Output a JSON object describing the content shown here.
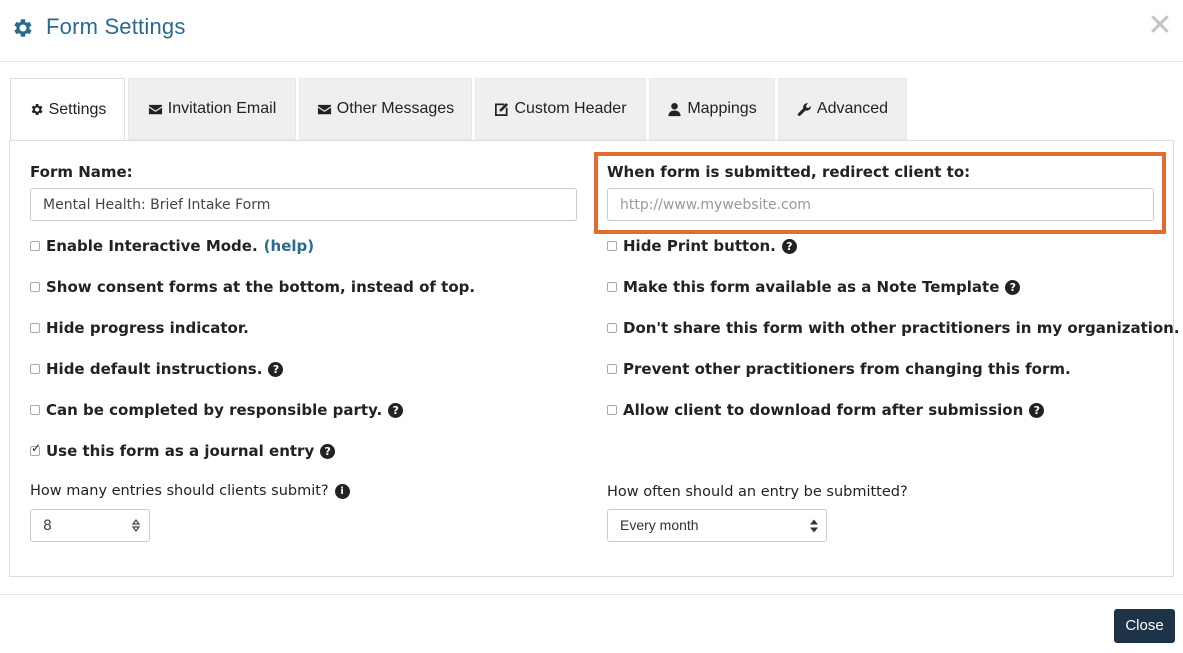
{
  "dialog": {
    "title": "Form Settings",
    "close_symbol": "✕",
    "icon": "gear-icon"
  },
  "tabs": [
    {
      "label": "Settings",
      "icon": "gear-icon",
      "active": true
    },
    {
      "label": "Invitation Email",
      "icon": "envelope-icon",
      "active": false
    },
    {
      "label": "Other Messages",
      "icon": "envelope-icon",
      "active": false
    },
    {
      "label": "Custom Header",
      "icon": "edit-icon",
      "active": false
    },
    {
      "label": "Mappings",
      "icon": "user-icon",
      "active": false
    },
    {
      "label": "Advanced",
      "icon": "wrench-icon",
      "active": false
    }
  ],
  "form": {
    "form_name_label": "Form Name:",
    "form_name_value": "Mental Health: Brief Intake Form",
    "redirect_label": "When form is submitted, redirect client to:",
    "redirect_placeholder": "http://www.mywebsite.com",
    "left_options": [
      {
        "label": "Enable Interactive Mode.",
        "help_link": "(help)",
        "checked": false
      },
      {
        "label": "Show consent forms at the bottom, instead of top.",
        "checked": false
      },
      {
        "label": "Hide progress indicator.",
        "checked": false
      },
      {
        "label": "Hide default instructions.",
        "checked": false,
        "help_icon": true
      },
      {
        "label": "Can be completed by responsible party.",
        "checked": false,
        "help_icon": true
      },
      {
        "label": "Use this form as a journal entry",
        "checked": true,
        "help_icon": true
      }
    ],
    "right_options": [
      {
        "label": "Hide Print button.",
        "checked": false,
        "help_icon": true
      },
      {
        "label": "Make this form available as a Note Template",
        "checked": false,
        "help_icon": true
      },
      {
        "label": "Don't share this form with other practitioners in my organization.",
        "checked": false
      },
      {
        "label": "Prevent other practitioners from changing this form.",
        "checked": false
      },
      {
        "label": "Allow client to download form after submission",
        "checked": false,
        "help_icon": true
      }
    ],
    "entries_label": "How many entries should clients submit?",
    "entries_value": "8",
    "frequency_label": "How often should an entry be submitted?",
    "frequency_value": "Every month"
  },
  "footer": {
    "close_label": "Close"
  },
  "colors": {
    "title": "#2a6a8f",
    "highlight": "#e06c2f",
    "close_button": "#1e3347"
  }
}
